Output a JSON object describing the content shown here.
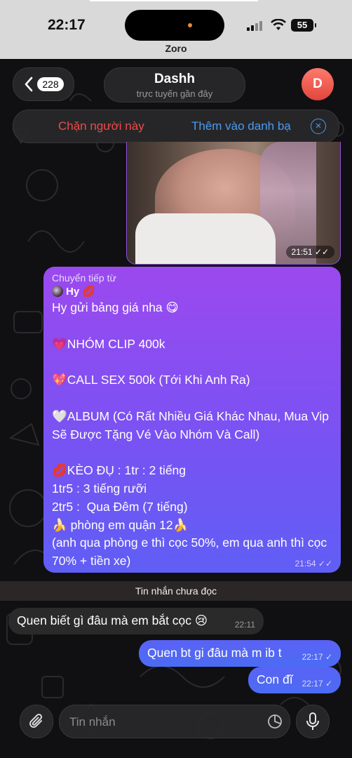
{
  "status_bar": {
    "time": "22:17",
    "app_label": "Zoro",
    "battery": "55"
  },
  "header": {
    "back_count": "228",
    "contact_name": "Dashh",
    "contact_status": "trực tuyến gần đây",
    "avatar_letter": "D",
    "block_label": "Chặn người này",
    "add_contact_label": "Thêm vào danh bạ"
  },
  "messages": {
    "photo_time": "21:51",
    "forwarded": {
      "label": "Chuyển tiếp từ",
      "from": "Hy 💋",
      "text": "Hy gửi bảng giá nha 😋\n\n💗NHÓM CLIP 400k\n\n💖CALL SEX 500k (Tới Khi Anh Ra)\n\n🤍ALBUM (Có Rất Nhiều Giá Khác Nhau, Mua Vip Sẽ Được Tặng Vé Vào Nhóm Và Call)\n\n💋KÈO ĐỤ : 1tr : 2 tiếng\n1tr5 : 3 tiếng rưỡi\n2tr5 :  Qua Đêm (7 tiếng)\n🍌 phòng em quận 12🍌\n(anh qua phòng e thì cọc 50%, em qua anh thì cọc 70% + tiền xe)",
      "time": "21:54"
    },
    "unread_separator": "Tin nhắn chưa đọc",
    "incoming": {
      "text": "Quen biết gì đâu mà em bắt cọc 😢",
      "time": "22:11"
    },
    "outgoing_1": {
      "text": "Quen bt gi đâu mà m ib t",
      "time": "22:17"
    },
    "outgoing_2": {
      "text": "Con đĩ",
      "time": "22:17"
    }
  },
  "composer": {
    "placeholder": "Tin nhắn"
  },
  "icons": [
    "chevron-left-icon",
    "close-circle-icon",
    "double-check-icon",
    "paperclip-icon",
    "sticker-icon",
    "microphone-icon",
    "wifi-icon",
    "signal-icon"
  ]
}
